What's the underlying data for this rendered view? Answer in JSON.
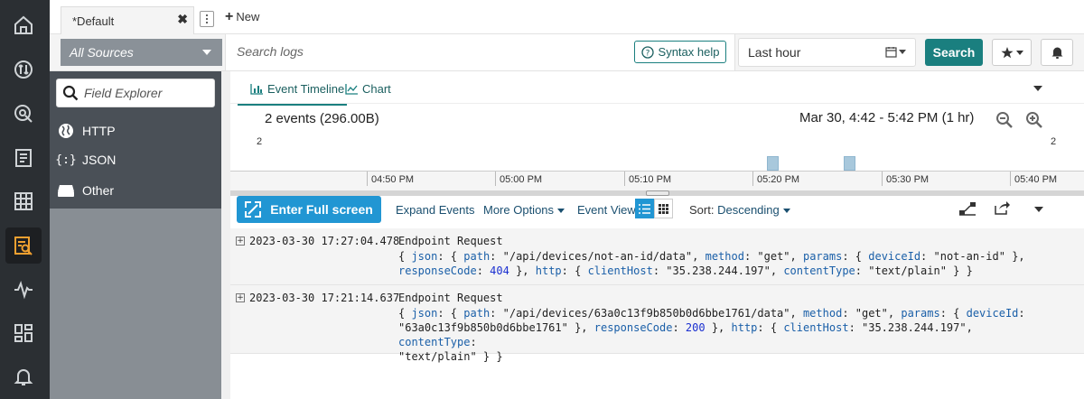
{
  "tabbar": {
    "active_tab": "*Default",
    "close_glyph": "✖",
    "new_tab_label": "New"
  },
  "toolbar": {
    "sources_label": "All Sources",
    "search_placeholder": "Search logs",
    "syntax_help_label": "Syntax help",
    "time_range": "Last hour",
    "search_label": "Search"
  },
  "field_explorer": {
    "placeholder": "Field Explorer",
    "items": [
      {
        "label": "HTTP",
        "icon": "globe-icon"
      },
      {
        "label": "JSON",
        "icon": "json-braces-icon"
      },
      {
        "label": "Other",
        "icon": "drive-icon"
      }
    ]
  },
  "viz": {
    "tab_timeline": "Event Timeline",
    "tab_chart": "Chart",
    "event_count": "2 events (296.00B)",
    "range_label": "Mar 30, 4:42 - 5:42 PM  (1 hr)",
    "y_left": "2",
    "y_right": "2",
    "ticks": [
      "04:50 PM",
      "05:00 PM",
      "05:10 PM",
      "05:20 PM",
      "05:30 PM",
      "05:40 PM"
    ]
  },
  "events_toolbar": {
    "fullscreen_label": "Enter Full screen",
    "expand_label": "Expand Events",
    "more_options_label": "More Options",
    "event_view_label": "Event View",
    "sort_prefix": "Sort:",
    "sort_value": "Descending"
  },
  "logs": [
    {
      "timestamp": "2023-03-30 17:27:04.478",
      "message": "Endpoint Request",
      "line1": {
        "a": "{ ",
        "k1": "json",
        "b": ": { ",
        "k2": "path",
        "c": ": \"/api/devices/not-an-id/data\", ",
        "k3": "method",
        "d": ": \"get\", ",
        "k4": "params",
        "e": ": { ",
        "k5": "deviceId",
        "f": ": \"not-an-id\" },"
      },
      "line2": {
        "k6": "responseCode",
        "g": ": ",
        "n1": "404",
        "h": " }, ",
        "k7": "http",
        "i": ": { ",
        "k8": "clientHost",
        "j": ": \"35.238.244.197\", ",
        "k9": "contentType",
        "l": ": \"text/plain\" } }"
      }
    },
    {
      "timestamp": "2023-03-30 17:21:14.637",
      "message": "Endpoint Request",
      "line1": {
        "a": "{ ",
        "k1": "json",
        "b": ": { ",
        "k2": "path",
        "c": ": \"/api/devices/63a0c13f9b850b0d6bbe1761/data\", ",
        "k3": "method",
        "d": ": \"get\", ",
        "k4": "params",
        "e": ": { ",
        "k5": "deviceId",
        "f": ":"
      },
      "line2": {
        "a": "\"63a0c13f9b850b0d6bbe1761\" }, ",
        "k6": "responseCode",
        "g": ": ",
        "n1": "200",
        "h": " }, ",
        "k7": "http",
        "i": ": { ",
        "k8": "clientHost",
        "j": ": \"35.238.244.197\", ",
        "k9": "contentType",
        "l": ":"
      },
      "line3": "\"text/plain\" } }"
    }
  ],
  "colors": {
    "accent_teal": "#1a7f7f",
    "fullscreen_blue": "#2196d3",
    "rail_bg": "#2b2f33",
    "active_rail_icon": "#f0a030"
  }
}
